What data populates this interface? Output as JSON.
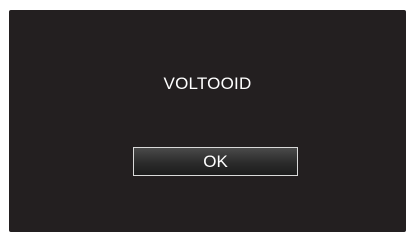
{
  "dialog": {
    "message": "VOLTOOID",
    "ok_label": "OK"
  },
  "colors": {
    "screen_background": "#231f20",
    "text": "#ffffff",
    "button_border": "#d9d9d9"
  }
}
